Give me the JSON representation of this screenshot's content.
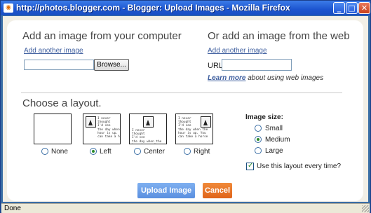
{
  "window": {
    "title": "http://photos.blogger.com - Blogger: Upload Images - Mozilla Firefox",
    "minimize": "_",
    "maximize": "□",
    "close": "✕"
  },
  "local": {
    "heading": "Add an image from your computer",
    "add_another": "Add another image",
    "browse_label": "Browse..."
  },
  "web": {
    "heading": "Or add an image from the web",
    "add_another": "Add another image",
    "url_label": "URL",
    "learn_more": "Learn more",
    "learn_more_rest": " about using web images"
  },
  "layout": {
    "heading": "Choose a layout.",
    "sample_text": "I never\nthought\nI'd see\nthe day when the\nhour is up. You\ncan take a horse",
    "options": [
      {
        "label": "None",
        "selected": false
      },
      {
        "label": "Left",
        "selected": true
      },
      {
        "label": "Center",
        "selected": false
      },
      {
        "label": "Right",
        "selected": false
      }
    ]
  },
  "size": {
    "title": "Image size:",
    "options": [
      {
        "label": "Small",
        "selected": false
      },
      {
        "label": "Medium",
        "selected": true
      },
      {
        "label": "Large",
        "selected": false
      }
    ],
    "remember_label": "Use this layout every time?",
    "remember_checked": true
  },
  "actions": {
    "upload": "Upload Image",
    "cancel": "Cancel"
  },
  "status": {
    "text": "Done"
  },
  "colors": {
    "titlebar": "#1c54cf",
    "link": "#3f5f9f",
    "upload_button": "#5a8fe0",
    "cancel_button": "#e0641a"
  }
}
